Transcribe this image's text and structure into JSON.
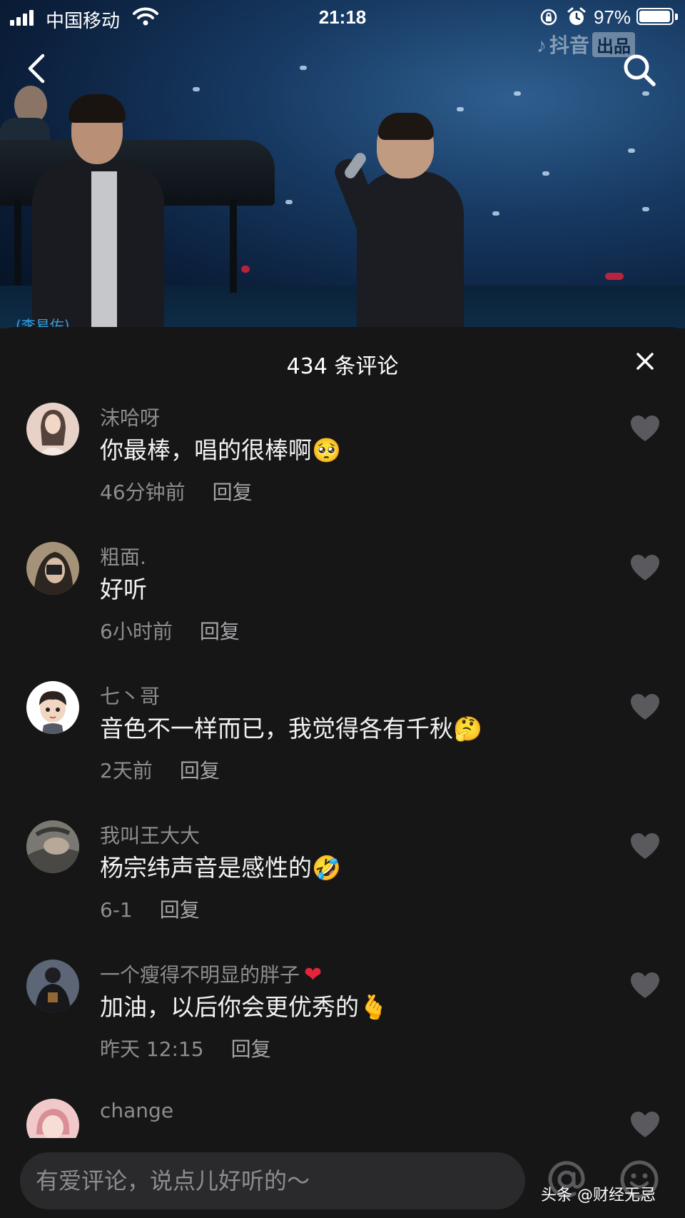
{
  "status_bar": {
    "carrier": "中国移动",
    "time": "21:18",
    "battery_percent_text": "97%",
    "battery_level": 0.97
  },
  "video": {
    "watermark": "抖音",
    "watermark_badge": "出品",
    "caption_partial": "(李易佐)"
  },
  "comments_panel": {
    "title": "434 条评论",
    "comments": [
      {
        "user": "沫哈呀",
        "text": "你最棒，唱的很棒啊",
        "emoji": "🥺",
        "time": "46分钟前",
        "reply": "回复",
        "avatar_color": "#d9b8a8"
      },
      {
        "user": "粗面.",
        "text": "好听",
        "emoji": "",
        "time": "6小时前",
        "reply": "回复",
        "avatar_color": "#8a7f6a"
      },
      {
        "user": "七丶哥",
        "text": "音色不一样而已，我觉得各有千秋",
        "emoji": "🤔",
        "time": "2天前",
        "reply": "回复",
        "avatar_color": "#ffffff"
      },
      {
        "user": "我叫王大大",
        "text": "杨宗纬声音是感性的",
        "emoji": "🤣",
        "time": "6-1",
        "reply": "回复",
        "avatar_color": "#6a6862"
      },
      {
        "user": "一个瘦得不明显的胖子",
        "user_emoji": "❤",
        "text": "加油，以后你会更优秀的",
        "emoji": "🫰",
        "time": "昨天 12:15",
        "reply": "回复",
        "avatar_color": "#3c4452"
      },
      {
        "user": "change",
        "text": "",
        "emoji": "",
        "time": "",
        "reply": "",
        "avatar_color": "#e9b7b9"
      }
    ]
  },
  "input_bar": {
    "placeholder": "有爱评论，说点儿好听的～",
    "brand_watermark": "头条 @财经无忌"
  },
  "icons": {
    "back": "chevron-left-icon",
    "search": "search-icon",
    "close": "close-icon",
    "like": "heart-icon",
    "mention": "at-icon",
    "emoji": "emoji-face-icon"
  },
  "colors": {
    "sheet_bg": "#161616",
    "muted_text": "#8d8d90",
    "like_heart": "#5a5a5e",
    "input_bg": "#2a2a2c"
  }
}
